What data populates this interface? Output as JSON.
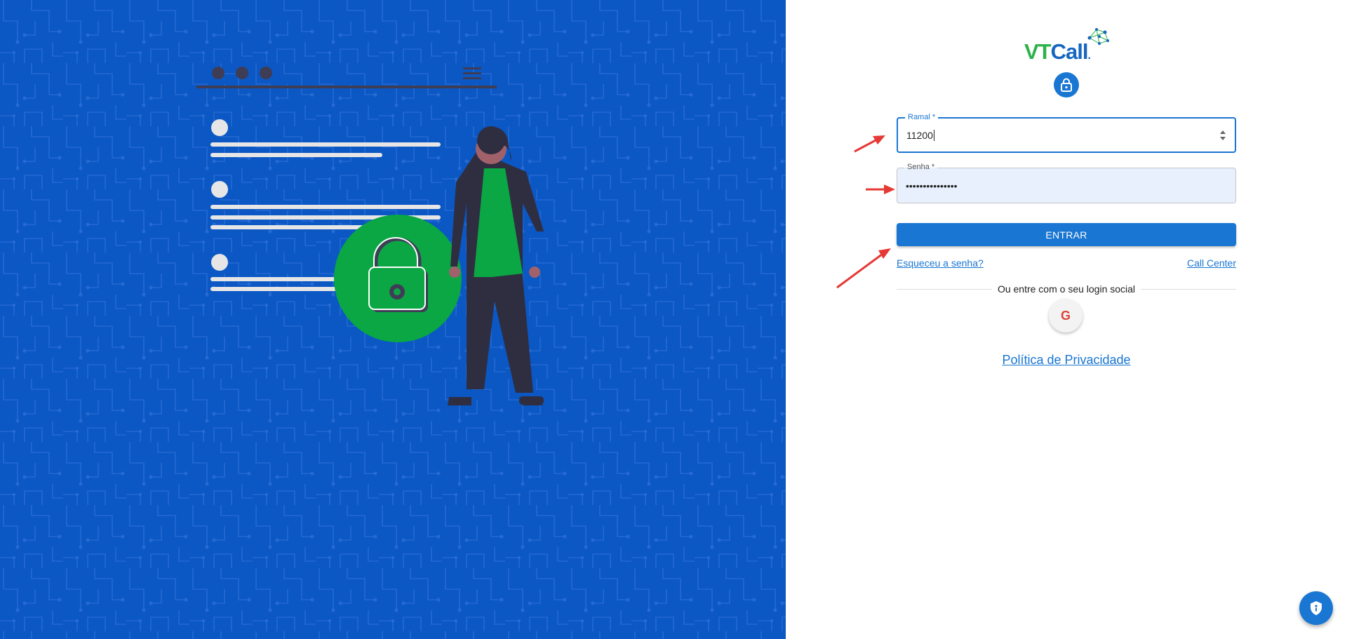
{
  "brand": {
    "logo_vt": "VT",
    "logo_call": "Call",
    "logo_dot": "."
  },
  "form": {
    "ramal": {
      "label": "Ramal *",
      "value": "11200"
    },
    "senha": {
      "label": "Senha *",
      "value": "•••••••••••••••"
    },
    "submit_label": "ENTRAR",
    "forgot_label": "Esqueceu a senha?",
    "call_center_label": "Call Center",
    "social_divider": "Ou entre com o seu login social",
    "google_letter": "G",
    "privacy_label": "Política de Privacidade"
  },
  "colors": {
    "left_panel_bg": "#0b57c4",
    "primary": "#1976d2",
    "brand_green": "#2db24a",
    "illustration_green": "#0aa744",
    "annotation_red": "#e53935"
  },
  "icons": {
    "header_lock": "lock-icon",
    "google": "google-icon",
    "privacy_fab": "shield-icon"
  }
}
